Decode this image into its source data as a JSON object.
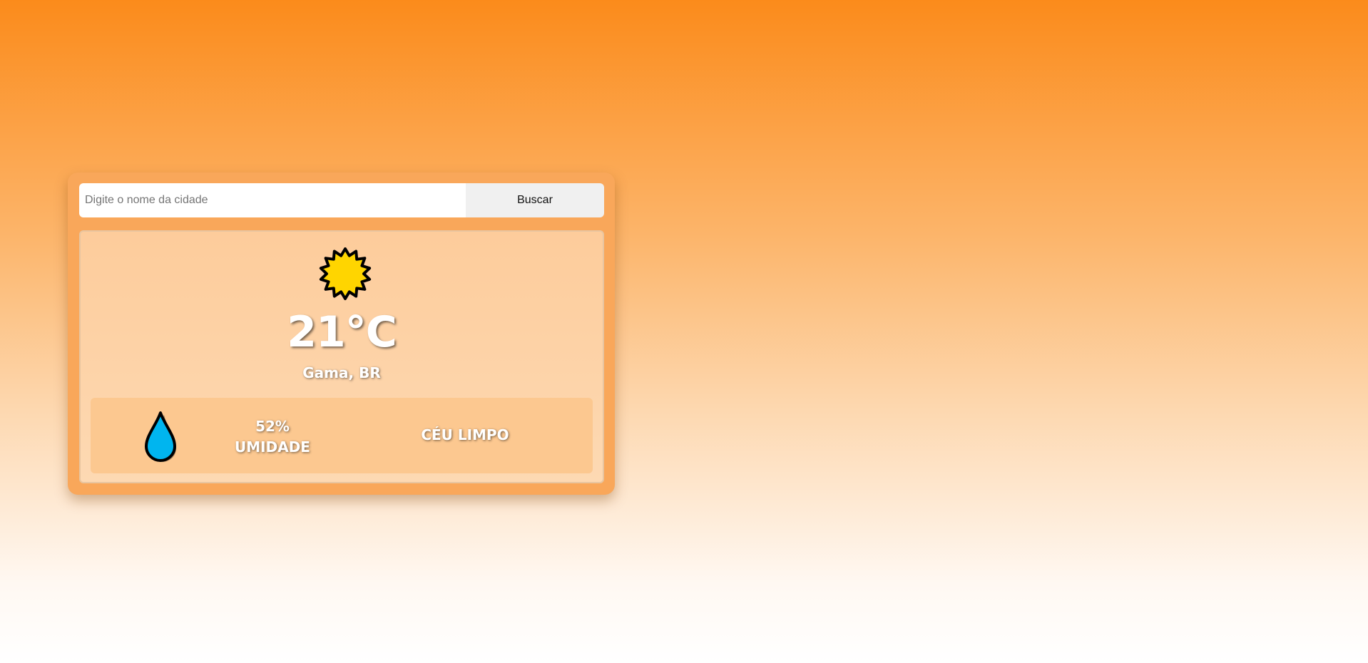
{
  "search": {
    "placeholder": "Digite o nome da cidade",
    "value": "",
    "button_label": "Buscar"
  },
  "weather": {
    "icon": "sun-icon",
    "temperature": "21°C",
    "location": "Gama, BR",
    "humidity_value": "52%",
    "humidity_label": "UMIDADE",
    "humidity_icon": "water-drop-icon",
    "condition": "CÉU LIMPO"
  },
  "colors": {
    "background_top": "#fb8b1b",
    "background_bottom": "#ffffff",
    "card": "#f9a75a",
    "sun_fill": "#ffd500",
    "drop_fill": "#00b5ef"
  }
}
